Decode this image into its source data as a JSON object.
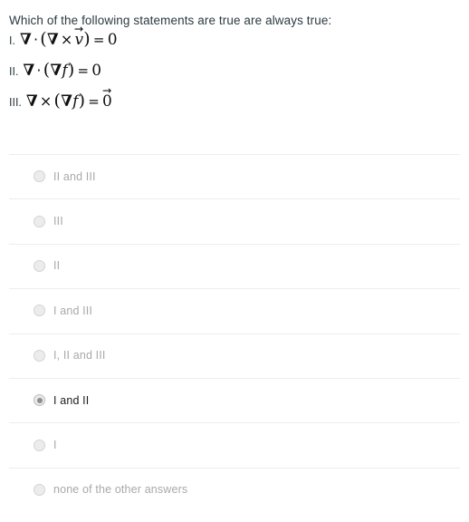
{
  "question": {
    "text": "Which of the following statements are true are always true:",
    "statements": [
      {
        "index": "I.",
        "latex": "\\nabla \\cdot (\\nabla \\times \\vec{v}) = 0",
        "plain": "∇ · (∇ × v⃗) = 0",
        "nabla": "∇",
        "operator": "·",
        "inner_operator": "×",
        "operand": "v",
        "operand_is_vector": true,
        "result": "0",
        "result_is_vector": false
      },
      {
        "index": "II.",
        "latex": "\\nabla \\cdot (\\nabla f) = 0",
        "plain": "∇ · (∇f) = 0",
        "nabla": "∇",
        "operator": "·",
        "inner_operator": "",
        "operand": "f",
        "operand_is_vector": false,
        "result": "0",
        "result_is_vector": false
      },
      {
        "index": "III.",
        "latex": "\\nabla \\times (\\nabla f) = \\vec{0}",
        "plain": "∇ × (∇f) = 0⃗",
        "nabla": "∇",
        "operator": "×",
        "inner_operator": "",
        "operand": "f",
        "operand_is_vector": false,
        "result": "0",
        "result_is_vector": true
      }
    ]
  },
  "answer_options": [
    {
      "id": "opt-ii-and-iii",
      "label": "II and III",
      "selected": false
    },
    {
      "id": "opt-iii",
      "label": "III",
      "selected": false
    },
    {
      "id": "opt-ii",
      "label": "II",
      "selected": false
    },
    {
      "id": "opt-i-and-iii",
      "label": "I and III",
      "selected": false
    },
    {
      "id": "opt-i-ii-and-iii",
      "label": "I, II and III",
      "selected": false
    },
    {
      "id": "opt-i-and-ii",
      "label": "I and II",
      "selected": true
    },
    {
      "id": "opt-i",
      "label": "I",
      "selected": false
    },
    {
      "id": "opt-none",
      "label": "none of the other answers",
      "selected": false
    }
  ],
  "colors": {
    "question_text": "#2b3a42",
    "math_text": "#111111",
    "option_label": "#a8a9aa",
    "option_label_selected": "#1d1d1d",
    "separator": "#eceded",
    "radio_fill": "#ececec",
    "radio_border": "#d2d3d4",
    "radio_dot_selected": "#8d8e8f",
    "background": "#ffffff"
  }
}
